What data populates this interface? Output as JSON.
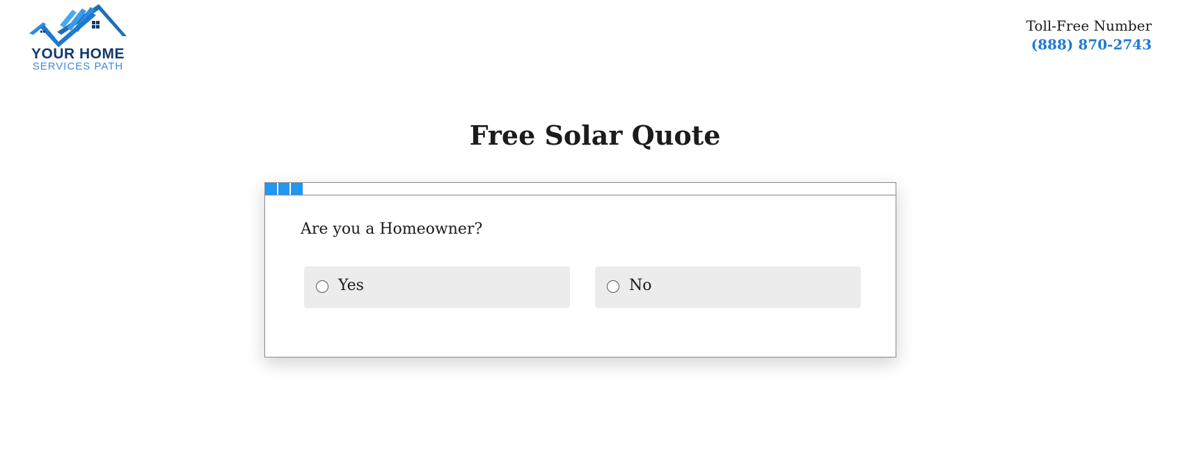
{
  "brand": {
    "name_line1": "YOUR HOME",
    "name_line2": "SERVICES PATH",
    "primary_color": "#123a6b",
    "accent_color": "#3a8ad6",
    "logo_icon": "house-roof-checkmark-icon"
  },
  "header": {
    "contact_label": "Toll-Free Number",
    "phone": "(888) 870-2743",
    "phone_color": "#1e7ad6"
  },
  "main": {
    "title": "Free Solar Quote"
  },
  "form": {
    "progress": {
      "filled_segments": 3,
      "color": "#2196f3"
    },
    "question": "Are you a Homeowner?",
    "options": [
      {
        "label": "Yes",
        "selected": false
      },
      {
        "label": "No",
        "selected": false
      }
    ]
  }
}
